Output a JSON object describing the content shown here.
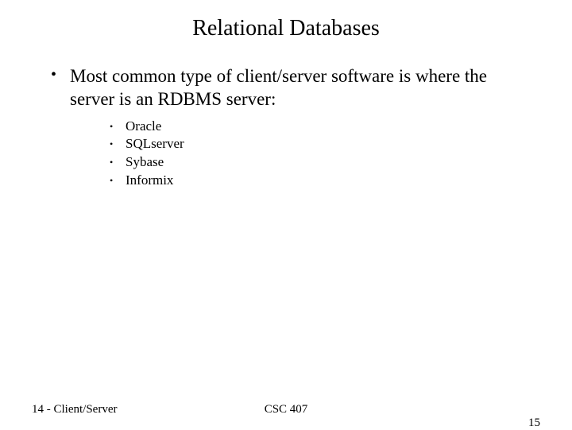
{
  "title": "Relational Databases",
  "bullet_main": "Most common type of client/server software is where the server is an RDBMS server:",
  "sub_items": {
    "i0": "Oracle",
    "i1": "SQLserver",
    "i2": "Sybase",
    "i3": "Informix"
  },
  "footer": {
    "left": "14 - Client/Server",
    "center": "CSC 407",
    "right": "15"
  }
}
